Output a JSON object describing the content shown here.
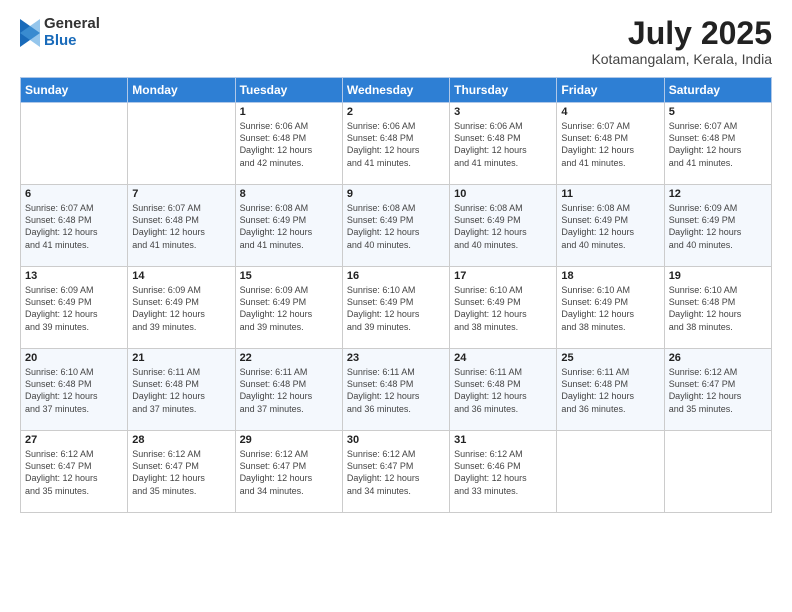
{
  "header": {
    "logo_general": "General",
    "logo_blue": "Blue",
    "month_year": "July 2025",
    "location": "Kotamangalam, Kerala, India"
  },
  "days_of_week": [
    "Sunday",
    "Monday",
    "Tuesday",
    "Wednesday",
    "Thursday",
    "Friday",
    "Saturday"
  ],
  "weeks": [
    [
      {
        "day": "",
        "info": ""
      },
      {
        "day": "",
        "info": ""
      },
      {
        "day": "1",
        "info": "Sunrise: 6:06 AM\nSunset: 6:48 PM\nDaylight: 12 hours\nand 42 minutes."
      },
      {
        "day": "2",
        "info": "Sunrise: 6:06 AM\nSunset: 6:48 PM\nDaylight: 12 hours\nand 41 minutes."
      },
      {
        "day": "3",
        "info": "Sunrise: 6:06 AM\nSunset: 6:48 PM\nDaylight: 12 hours\nand 41 minutes."
      },
      {
        "day": "4",
        "info": "Sunrise: 6:07 AM\nSunset: 6:48 PM\nDaylight: 12 hours\nand 41 minutes."
      },
      {
        "day": "5",
        "info": "Sunrise: 6:07 AM\nSunset: 6:48 PM\nDaylight: 12 hours\nand 41 minutes."
      }
    ],
    [
      {
        "day": "6",
        "info": "Sunrise: 6:07 AM\nSunset: 6:48 PM\nDaylight: 12 hours\nand 41 minutes."
      },
      {
        "day": "7",
        "info": "Sunrise: 6:07 AM\nSunset: 6:48 PM\nDaylight: 12 hours\nand 41 minutes."
      },
      {
        "day": "8",
        "info": "Sunrise: 6:08 AM\nSunset: 6:49 PM\nDaylight: 12 hours\nand 41 minutes."
      },
      {
        "day": "9",
        "info": "Sunrise: 6:08 AM\nSunset: 6:49 PM\nDaylight: 12 hours\nand 40 minutes."
      },
      {
        "day": "10",
        "info": "Sunrise: 6:08 AM\nSunset: 6:49 PM\nDaylight: 12 hours\nand 40 minutes."
      },
      {
        "day": "11",
        "info": "Sunrise: 6:08 AM\nSunset: 6:49 PM\nDaylight: 12 hours\nand 40 minutes."
      },
      {
        "day": "12",
        "info": "Sunrise: 6:09 AM\nSunset: 6:49 PM\nDaylight: 12 hours\nand 40 minutes."
      }
    ],
    [
      {
        "day": "13",
        "info": "Sunrise: 6:09 AM\nSunset: 6:49 PM\nDaylight: 12 hours\nand 39 minutes."
      },
      {
        "day": "14",
        "info": "Sunrise: 6:09 AM\nSunset: 6:49 PM\nDaylight: 12 hours\nand 39 minutes."
      },
      {
        "day": "15",
        "info": "Sunrise: 6:09 AM\nSunset: 6:49 PM\nDaylight: 12 hours\nand 39 minutes."
      },
      {
        "day": "16",
        "info": "Sunrise: 6:10 AM\nSunset: 6:49 PM\nDaylight: 12 hours\nand 39 minutes."
      },
      {
        "day": "17",
        "info": "Sunrise: 6:10 AM\nSunset: 6:49 PM\nDaylight: 12 hours\nand 38 minutes."
      },
      {
        "day": "18",
        "info": "Sunrise: 6:10 AM\nSunset: 6:49 PM\nDaylight: 12 hours\nand 38 minutes."
      },
      {
        "day": "19",
        "info": "Sunrise: 6:10 AM\nSunset: 6:48 PM\nDaylight: 12 hours\nand 38 minutes."
      }
    ],
    [
      {
        "day": "20",
        "info": "Sunrise: 6:10 AM\nSunset: 6:48 PM\nDaylight: 12 hours\nand 37 minutes."
      },
      {
        "day": "21",
        "info": "Sunrise: 6:11 AM\nSunset: 6:48 PM\nDaylight: 12 hours\nand 37 minutes."
      },
      {
        "day": "22",
        "info": "Sunrise: 6:11 AM\nSunset: 6:48 PM\nDaylight: 12 hours\nand 37 minutes."
      },
      {
        "day": "23",
        "info": "Sunrise: 6:11 AM\nSunset: 6:48 PM\nDaylight: 12 hours\nand 36 minutes."
      },
      {
        "day": "24",
        "info": "Sunrise: 6:11 AM\nSunset: 6:48 PM\nDaylight: 12 hours\nand 36 minutes."
      },
      {
        "day": "25",
        "info": "Sunrise: 6:11 AM\nSunset: 6:48 PM\nDaylight: 12 hours\nand 36 minutes."
      },
      {
        "day": "26",
        "info": "Sunrise: 6:12 AM\nSunset: 6:47 PM\nDaylight: 12 hours\nand 35 minutes."
      }
    ],
    [
      {
        "day": "27",
        "info": "Sunrise: 6:12 AM\nSunset: 6:47 PM\nDaylight: 12 hours\nand 35 minutes."
      },
      {
        "day": "28",
        "info": "Sunrise: 6:12 AM\nSunset: 6:47 PM\nDaylight: 12 hours\nand 35 minutes."
      },
      {
        "day": "29",
        "info": "Sunrise: 6:12 AM\nSunset: 6:47 PM\nDaylight: 12 hours\nand 34 minutes."
      },
      {
        "day": "30",
        "info": "Sunrise: 6:12 AM\nSunset: 6:47 PM\nDaylight: 12 hours\nand 34 minutes."
      },
      {
        "day": "31",
        "info": "Sunrise: 6:12 AM\nSunset: 6:46 PM\nDaylight: 12 hours\nand 33 minutes."
      },
      {
        "day": "",
        "info": ""
      },
      {
        "day": "",
        "info": ""
      }
    ]
  ]
}
